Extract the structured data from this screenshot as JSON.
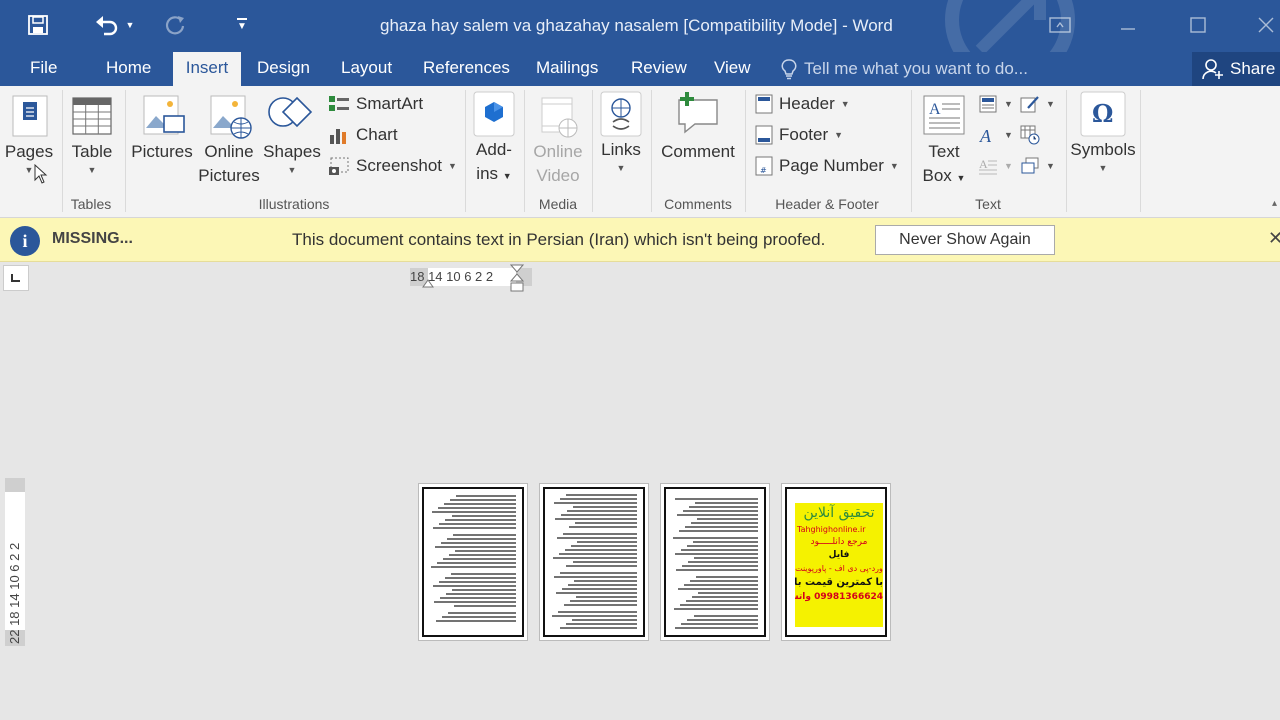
{
  "window": {
    "title": "ghaza hay salem va ghazahay nasalem [Compatibility Mode] - Word"
  },
  "tabs": [
    {
      "label": "File"
    },
    {
      "label": "Home"
    },
    {
      "label": "Insert",
      "active": true
    },
    {
      "label": "Design"
    },
    {
      "label": "Layout"
    },
    {
      "label": "References"
    },
    {
      "label": "Mailings"
    },
    {
      "label": "Review"
    },
    {
      "label": "View"
    }
  ],
  "tell_me": {
    "placeholder": "Tell me what you want to do..."
  },
  "share": {
    "label": "Share"
  },
  "ribbon": {
    "pages": {
      "label": "Pages"
    },
    "tables": {
      "table": "Table",
      "group": "Tables"
    },
    "illustrations": {
      "pictures": "Pictures",
      "online_pictures": [
        "Online",
        "Pictures"
      ],
      "shapes": "Shapes",
      "smartart": "SmartArt",
      "chart": "Chart",
      "screenshot": "Screenshot",
      "group": "Illustrations"
    },
    "addins": {
      "label": [
        "Add-",
        "ins"
      ]
    },
    "media": {
      "online_video": [
        "Online",
        "Video"
      ],
      "group": "Media"
    },
    "links": {
      "label": "Links"
    },
    "comments": {
      "comment": "Comment",
      "group": "Comments"
    },
    "header_footer": {
      "header": "Header",
      "footer": "Footer",
      "page_number": "Page Number",
      "group": "Header & Footer"
    },
    "text": {
      "text_box": [
        "Text",
        "Box"
      ],
      "group": "Text"
    },
    "symbols": {
      "label": "Symbols"
    }
  },
  "message_bar": {
    "title": "MISSING...",
    "text": "This document contains text in Persian (Iran) which isn't being proofed.",
    "button": "Never Show Again"
  },
  "rulers": {
    "horizontal": "18 14 10  6   2  2",
    "vertical": "22 18 14 10  6   2   2"
  },
  "pages": {
    "count": 4,
    "ad": {
      "title": "تحقیق آنلاین",
      "site": "Tahghighonline.ir",
      "line1": "مرجع دانلـــــود",
      "line2": "فایل",
      "line3": "ورد-پی دی اف - پاورپوینت",
      "line4": "با کمترین قیمت بازار",
      "phone": "09981366624 واتساپ"
    }
  },
  "colors": {
    "accent": "#2b579a",
    "ribbon_bg": "#f3f3f3",
    "message_bar_bg": "#fcf7b6",
    "workspace_bg": "#e6e6e6"
  }
}
